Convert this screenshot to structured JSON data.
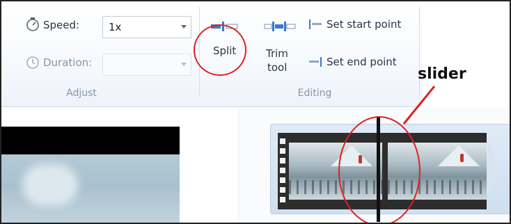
{
  "ribbon": {
    "adjust_group": {
      "speed_label": "Speed:",
      "speed_value": "1x",
      "duration_label": "Duration:",
      "duration_value": "",
      "group_label": "Adjust",
      "icons": [
        "speed-icon",
        "duration-icon"
      ]
    },
    "editing_group": {
      "split_label": "Split",
      "trim_label_line1": "Trim",
      "trim_label_line2": "tool",
      "set_start_label": "Set start point",
      "set_end_label": "Set end point",
      "group_label": "Editing",
      "icons": [
        "split-icon",
        "trim-tool-icon",
        "set-start-icon",
        "set-end-icon"
      ]
    }
  },
  "annotation": {
    "slider_label": "slider",
    "highlight_color": "#e02020"
  },
  "timeline": {
    "clip_count": 1
  },
  "colors": {
    "accent": "#2b7ad3",
    "ribbon_text": "#2a3446",
    "disabled_text": "#8a94a3"
  }
}
